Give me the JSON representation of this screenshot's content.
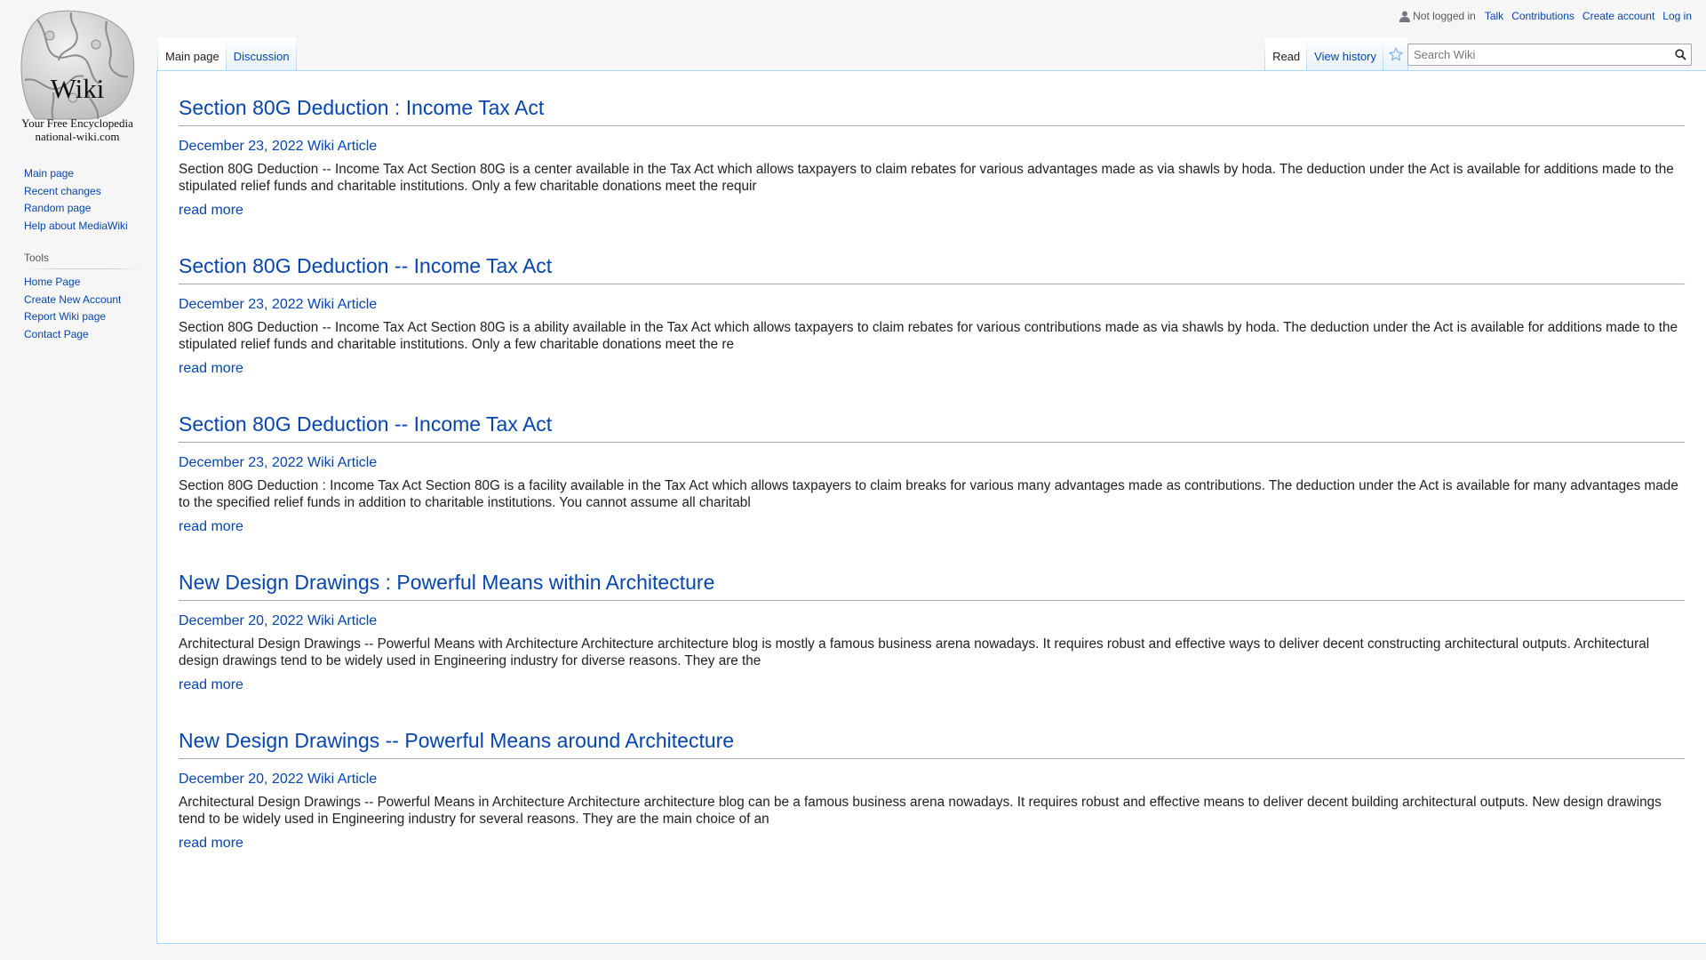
{
  "logo": {
    "word": "Wiki",
    "tagline": "Your Free Encyclopedia",
    "domain": "national-wiki.com"
  },
  "sidebar": {
    "nav": [
      "Main page",
      "Recent changes",
      "Random page",
      "Help about MediaWiki"
    ],
    "tools_heading": "Tools",
    "tools": [
      "Home Page",
      "Create New Account",
      "Report Wiki page",
      "Contact Page"
    ]
  },
  "personal": {
    "status": "Not logged in",
    "links": [
      "Talk",
      "Contributions",
      "Create account",
      "Log in"
    ]
  },
  "tabs": {
    "left": [
      "Main page",
      "Discussion"
    ],
    "right": [
      "Read",
      "View history"
    ]
  },
  "search": {
    "placeholder": "Search Wiki"
  },
  "articles": [
    {
      "title": "Section 80G Deduction : Income Tax Act",
      "meta": "December 23, 2022 Wiki Article",
      "excerpt": "Section 80G Deduction -- Income Tax Act Section 80G is a center available in the Tax Act which allows taxpayers to claim rebates for various advantages made as via shawls by hoda. The deduction under the Act is available for additions made to the stipulated relief funds and charitable institutions. Only a few charitable donations meet the requir",
      "read_more": "read more"
    },
    {
      "title": "Section 80G Deduction -- Income Tax Act",
      "meta": "December 23, 2022 Wiki Article",
      "excerpt": "Section 80G Deduction -- Income Tax Act Section 80G is a ability available in the Tax Act which allows taxpayers to claim rebates for various contributions made as via shawls by hoda. The deduction under the Act is available for additions made to the stipulated relief funds and charitable institutions. Only a few charitable donations meet the re",
      "read_more": "read more"
    },
    {
      "title": "Section 80G Deduction -- Income Tax Act",
      "meta": "December 23, 2022 Wiki Article",
      "excerpt": "Section 80G Deduction : Income Tax Act Section 80G is a facility available in the Tax Act which allows taxpayers to claim breaks for various many advantages made as contributions. The deduction under the Act is available for many advantages made to the specified relief funds in addition to charitable institutions. You cannot assume all charitabl",
      "read_more": "read more"
    },
    {
      "title": "New Design Drawings : Powerful Means within Architecture",
      "meta": "December 20, 2022 Wiki Article",
      "excerpt": "Architectural Design Drawings -- Powerful Means with Architecture Architecture architecture blog is mostly a famous business arena nowadays. It requires robust and effective ways to deliver decent constructing architectural outputs. Architectural design drawings tend to be widely used in Engineering industry for diverse reasons. They are the",
      "read_more": "read more"
    },
    {
      "title": "New Design Drawings -- Powerful Means around Architecture",
      "meta": "December 20, 2022 Wiki Article",
      "excerpt": "Architectural Design Drawings -- Powerful Means in Architecture Architecture architecture blog can be a famous business arena nowadays. It requires robust and effective means to deliver decent building architectural outputs. New design drawings tend to be widely used in Engineering industry for several reasons. They are the main choice of an",
      "read_more": "read more"
    }
  ],
  "colors": {
    "link": "#0645ad",
    "text": "#202122",
    "background": "#f6f6f6",
    "content_border": "#a7d7f9"
  }
}
